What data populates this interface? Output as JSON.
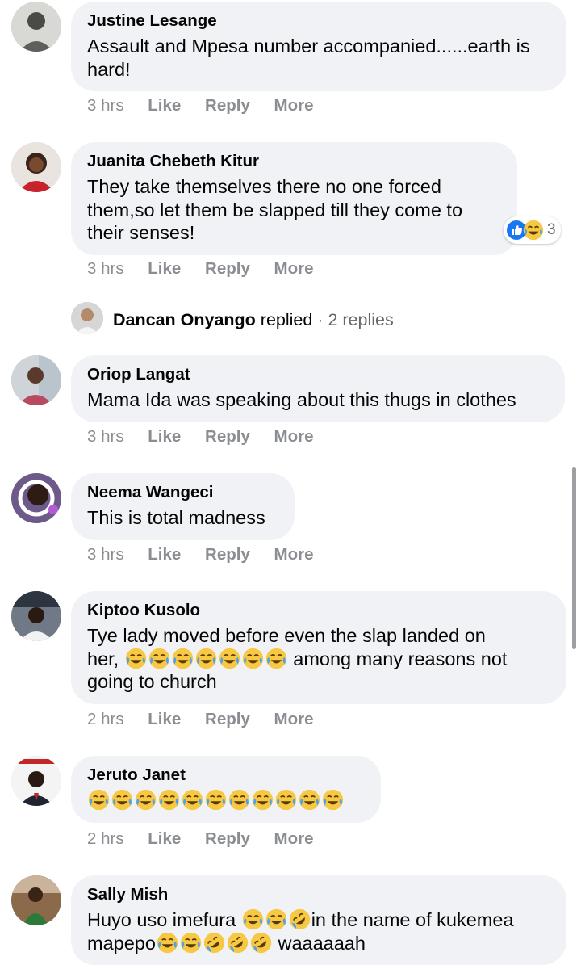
{
  "comments": [
    {
      "name": "Justine Lesange",
      "text": "Assault and Mpesa number accompanied......earth is hard!",
      "time": "3 hrs"
    },
    {
      "name": "Juanita Chebeth Kitur",
      "text": "They take themselves there no one forced them,so let them be slapped till they come to their senses!",
      "time": "3 hrs",
      "reaction_count": "3"
    },
    {
      "name": "Oriop Langat",
      "text": "Mama Ida was speaking about this thugs in clothes",
      "time": "3 hrs"
    },
    {
      "name": "Neema Wangeci",
      "text": "This is total madness",
      "time": "3 hrs"
    },
    {
      "name": "Kiptoo Kusolo",
      "text_a": "Tye lady moved before even the slap landed on",
      "text_b": "her,",
      "text_c": "among many reasons not",
      "text_d": "going to church",
      "time": "2 hrs"
    },
    {
      "name": "Jeruto Janet",
      "time": "2 hrs"
    },
    {
      "name": "Sally Mish",
      "text_a": "Huyo uso imefura",
      "text_b": "in the name of kukemea",
      "text_c": "mapepo",
      "text_d": "waaaaaah"
    }
  ],
  "actions": {
    "like": "Like",
    "reply": "Reply",
    "more": "More"
  },
  "reply_summary": {
    "name": "Dancan Onyango",
    "verb": "replied",
    "count": "· 2 replies"
  },
  "colors": {
    "bubble": "#f0f2f5",
    "meta": "#8a8d91",
    "like_blue": "#1877f2",
    "emoji_yellow": "#f7c844"
  }
}
